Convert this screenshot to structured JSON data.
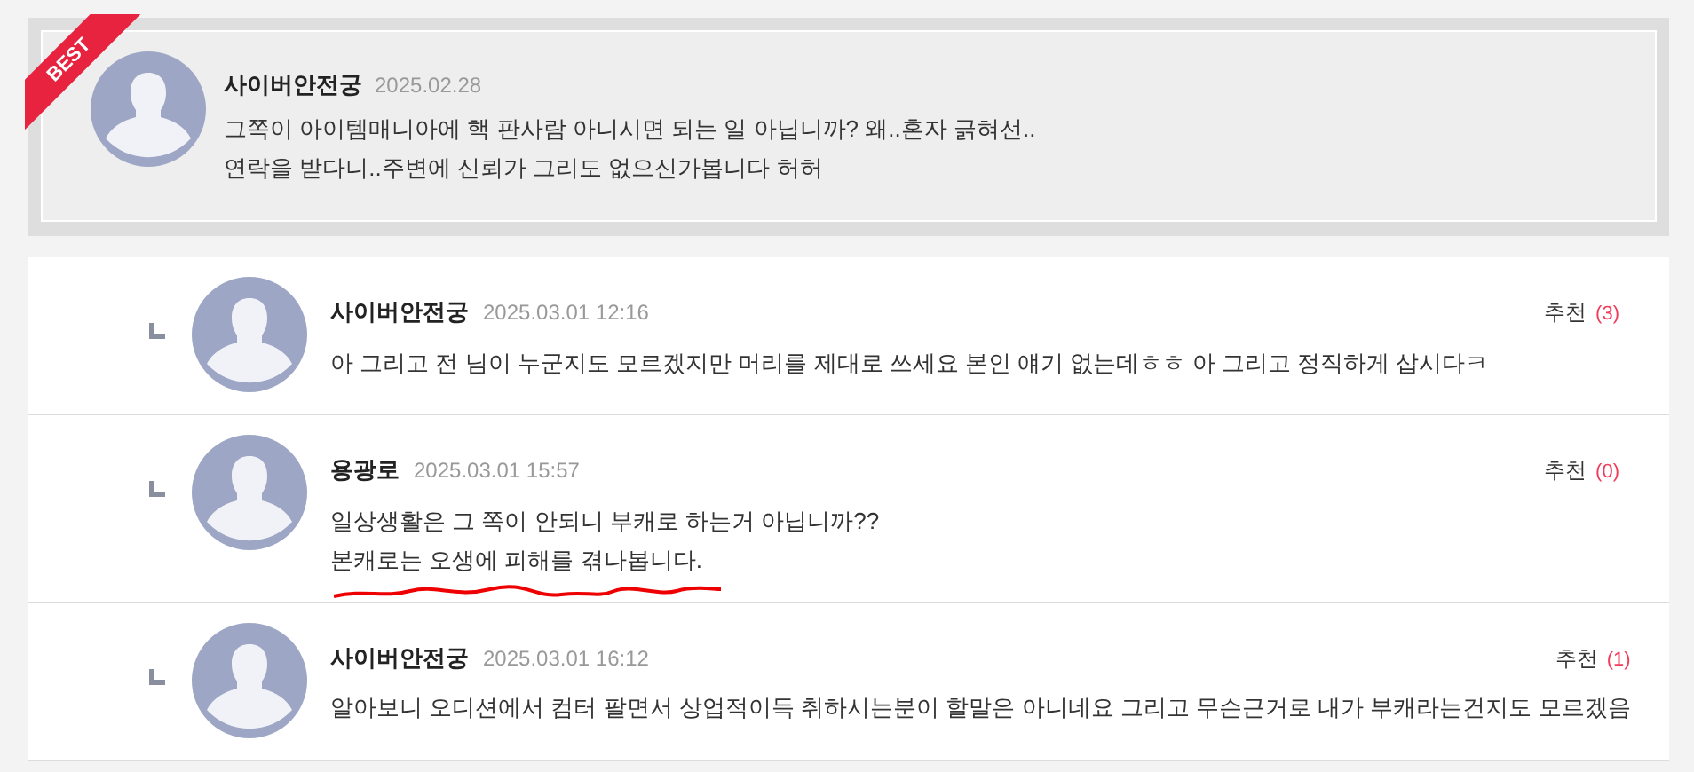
{
  "best_comment": {
    "badge": "BEST",
    "author": "사이버안전궁",
    "date": "2025.02.28",
    "lines": [
      "그쪽이 아이템매니아에 핵 판사람 아니시면 되는 일 아닙니까? 왜..혼자 긁혀선..",
      "연락을 받다니..주변에 신뢰가 그리도 없으신가봅니다 허허"
    ]
  },
  "replies": [
    {
      "author": "사이버안전궁",
      "date": "2025.03.01 12:16",
      "recommend_label": "추천",
      "recommend_count": "(3)",
      "lines": [
        "아 그리고 전 님이 누군지도 모르겠지만 머리를 제대로 쓰세요 본인 얘기 없는데ㅎㅎ 아 그리고 정직하게 삽시다ㅋ"
      ],
      "underlined": false
    },
    {
      "author": "용광로",
      "date": "2025.03.01 15:57",
      "recommend_label": "추천",
      "recommend_count": "(0)",
      "lines": [
        "일상생활은 그 쪽이 안되니 부캐로 하는거 아닙니까??",
        "본캐로는 오생에 피해를 겪나봅니다."
      ],
      "underlined": true
    },
    {
      "author": "사이버안전궁",
      "date": "2025.03.01 16:12",
      "recommend_label": "추천",
      "recommend_count": "(1)",
      "lines": [
        "알아보니 오디션에서 컴터 팔면서 상업적이득 취하시는분이 할말은 아니네요 그리고 무슨근거로 내가 부캐라는건지도 모르겠음"
      ],
      "underlined": false
    }
  ]
}
